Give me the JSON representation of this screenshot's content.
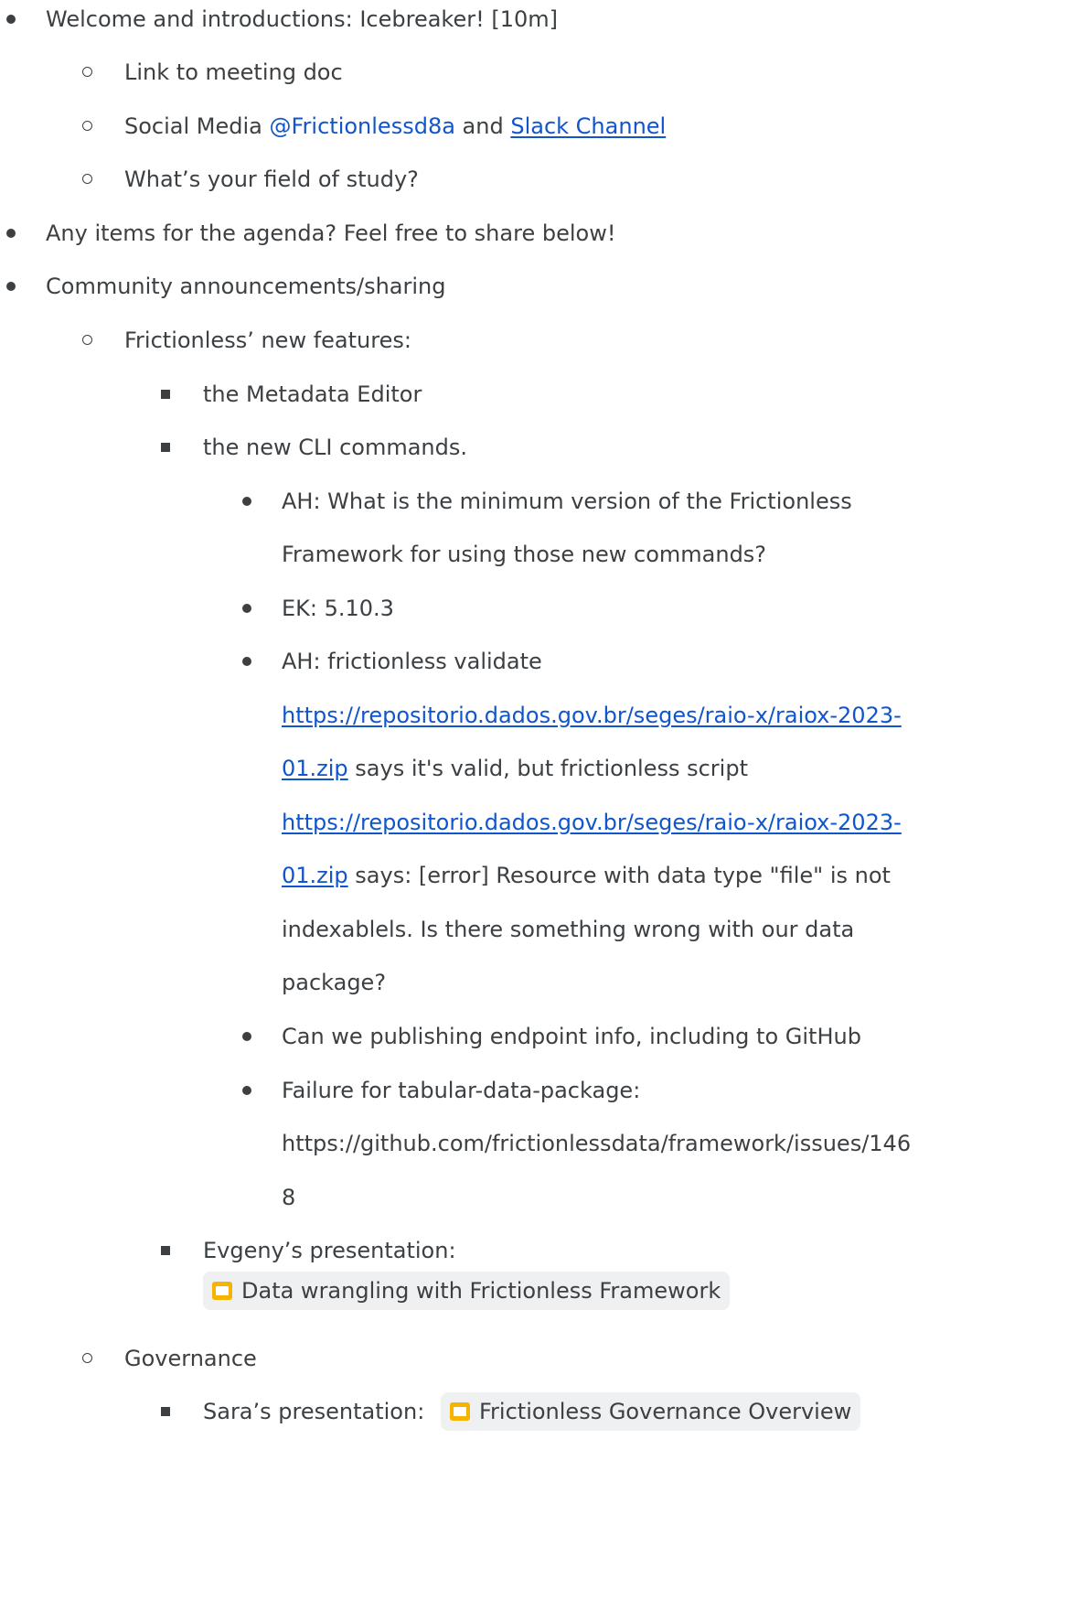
{
  "items": {
    "welcome": "Welcome and introductions: Icebreaker! [10m]",
    "meeting_doc": "Link to meeting doc",
    "social_prefix": "Social Media ",
    "social_handle": "@Frictionlessd8a",
    "social_and": " and ",
    "slack_link": "Slack Channel",
    "field_study": "What’s your field of study?",
    "agenda": "Any items for the agenda? Feel free to share below!",
    "community": "Community announcements/sharing",
    "new_features": "Frictionless’ new features:",
    "metadata_editor": "the Metadata Editor",
    "cli_commands": "the new CLI commands.",
    "ah_q1_line1": "AH: What is the minimum version of the Frictionless",
    "ah_q1_line2": "Framework for using those new commands?",
    "ek_answer": "EK: 5.10.3",
    "ah_q2_line1": "AH: frictionless validate",
    "ah_q2_link1_a": "https://repositorio.dados.gov.br/seges/raio-x/raiox-2023-",
    "ah_q2_link1_b": "01.zip",
    "ah_q2_mid": " says it's valid, but frictionless script",
    "ah_q2_link2_a": "https://repositorio.dados.gov.br/seges/raio-x/raiox-2023-",
    "ah_q2_link2_b": "01.zip",
    "ah_q2_err1": " says: [error] Resource with data type \"file\" is not",
    "ah_q2_err2": "indexablels. Is there something wrong with our data",
    "ah_q2_err3": "package?",
    "publishing": "Can we publishing endpoint info, including to GitHub",
    "failure_line1": "Failure for tabular-data-package:",
    "failure_line2": "https://github.com/frictionlessdata/framework/issues/146",
    "failure_line3": "8",
    "evgeny": "Evgeny’s presentation:",
    "evgeny_chip": "Data wrangling with Frictionless Framework",
    "governance": "Governance",
    "sara": "Sara’s presentation: ",
    "sara_chip": "Frictionless Governance Overview"
  }
}
